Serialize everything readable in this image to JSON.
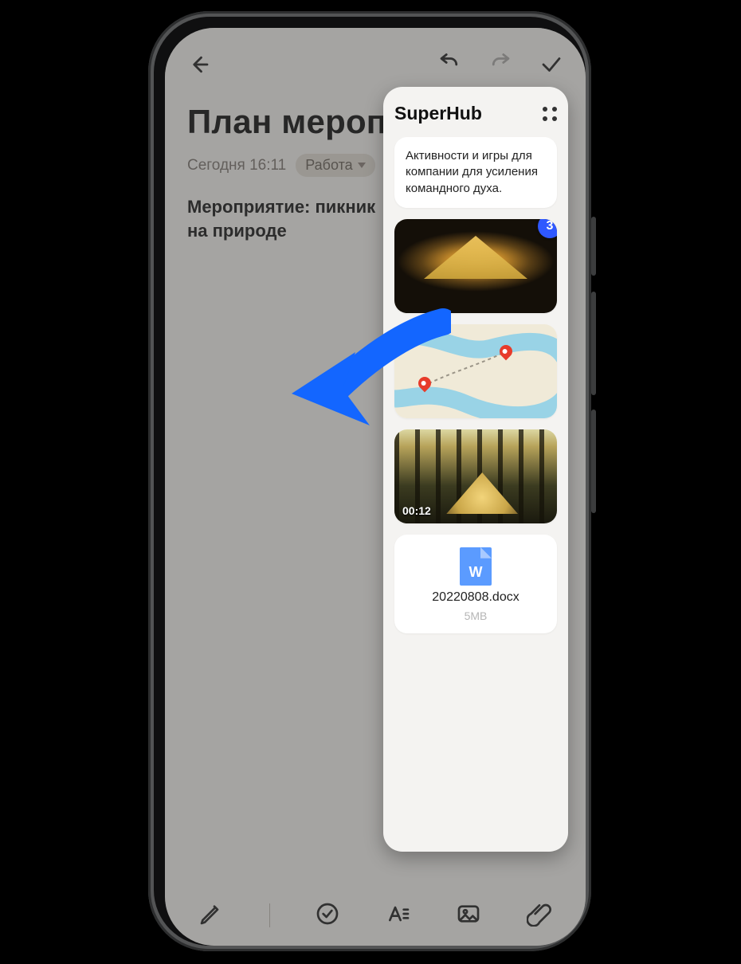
{
  "note": {
    "title": "План меропр",
    "timestamp": "Сегодня 16:11",
    "tag": "Работа",
    "body": "Мероприятие: пикник на природе"
  },
  "superhub": {
    "title": "SuperHub",
    "text_card": "Активности и игры для компании для усиления командного духа.",
    "stack_count": "3",
    "video_time": "00:12",
    "doc": {
      "name": "20220808.docx",
      "size": "5MB",
      "letter": "W"
    }
  },
  "icons": {
    "back": "back-arrow-icon",
    "undo": "undo-icon",
    "redo": "redo-icon",
    "confirm": "check-icon",
    "pen": "pen-icon",
    "checklist": "check-circle-icon",
    "format": "text-format-icon",
    "image": "image-icon",
    "attach": "attachment-icon"
  }
}
